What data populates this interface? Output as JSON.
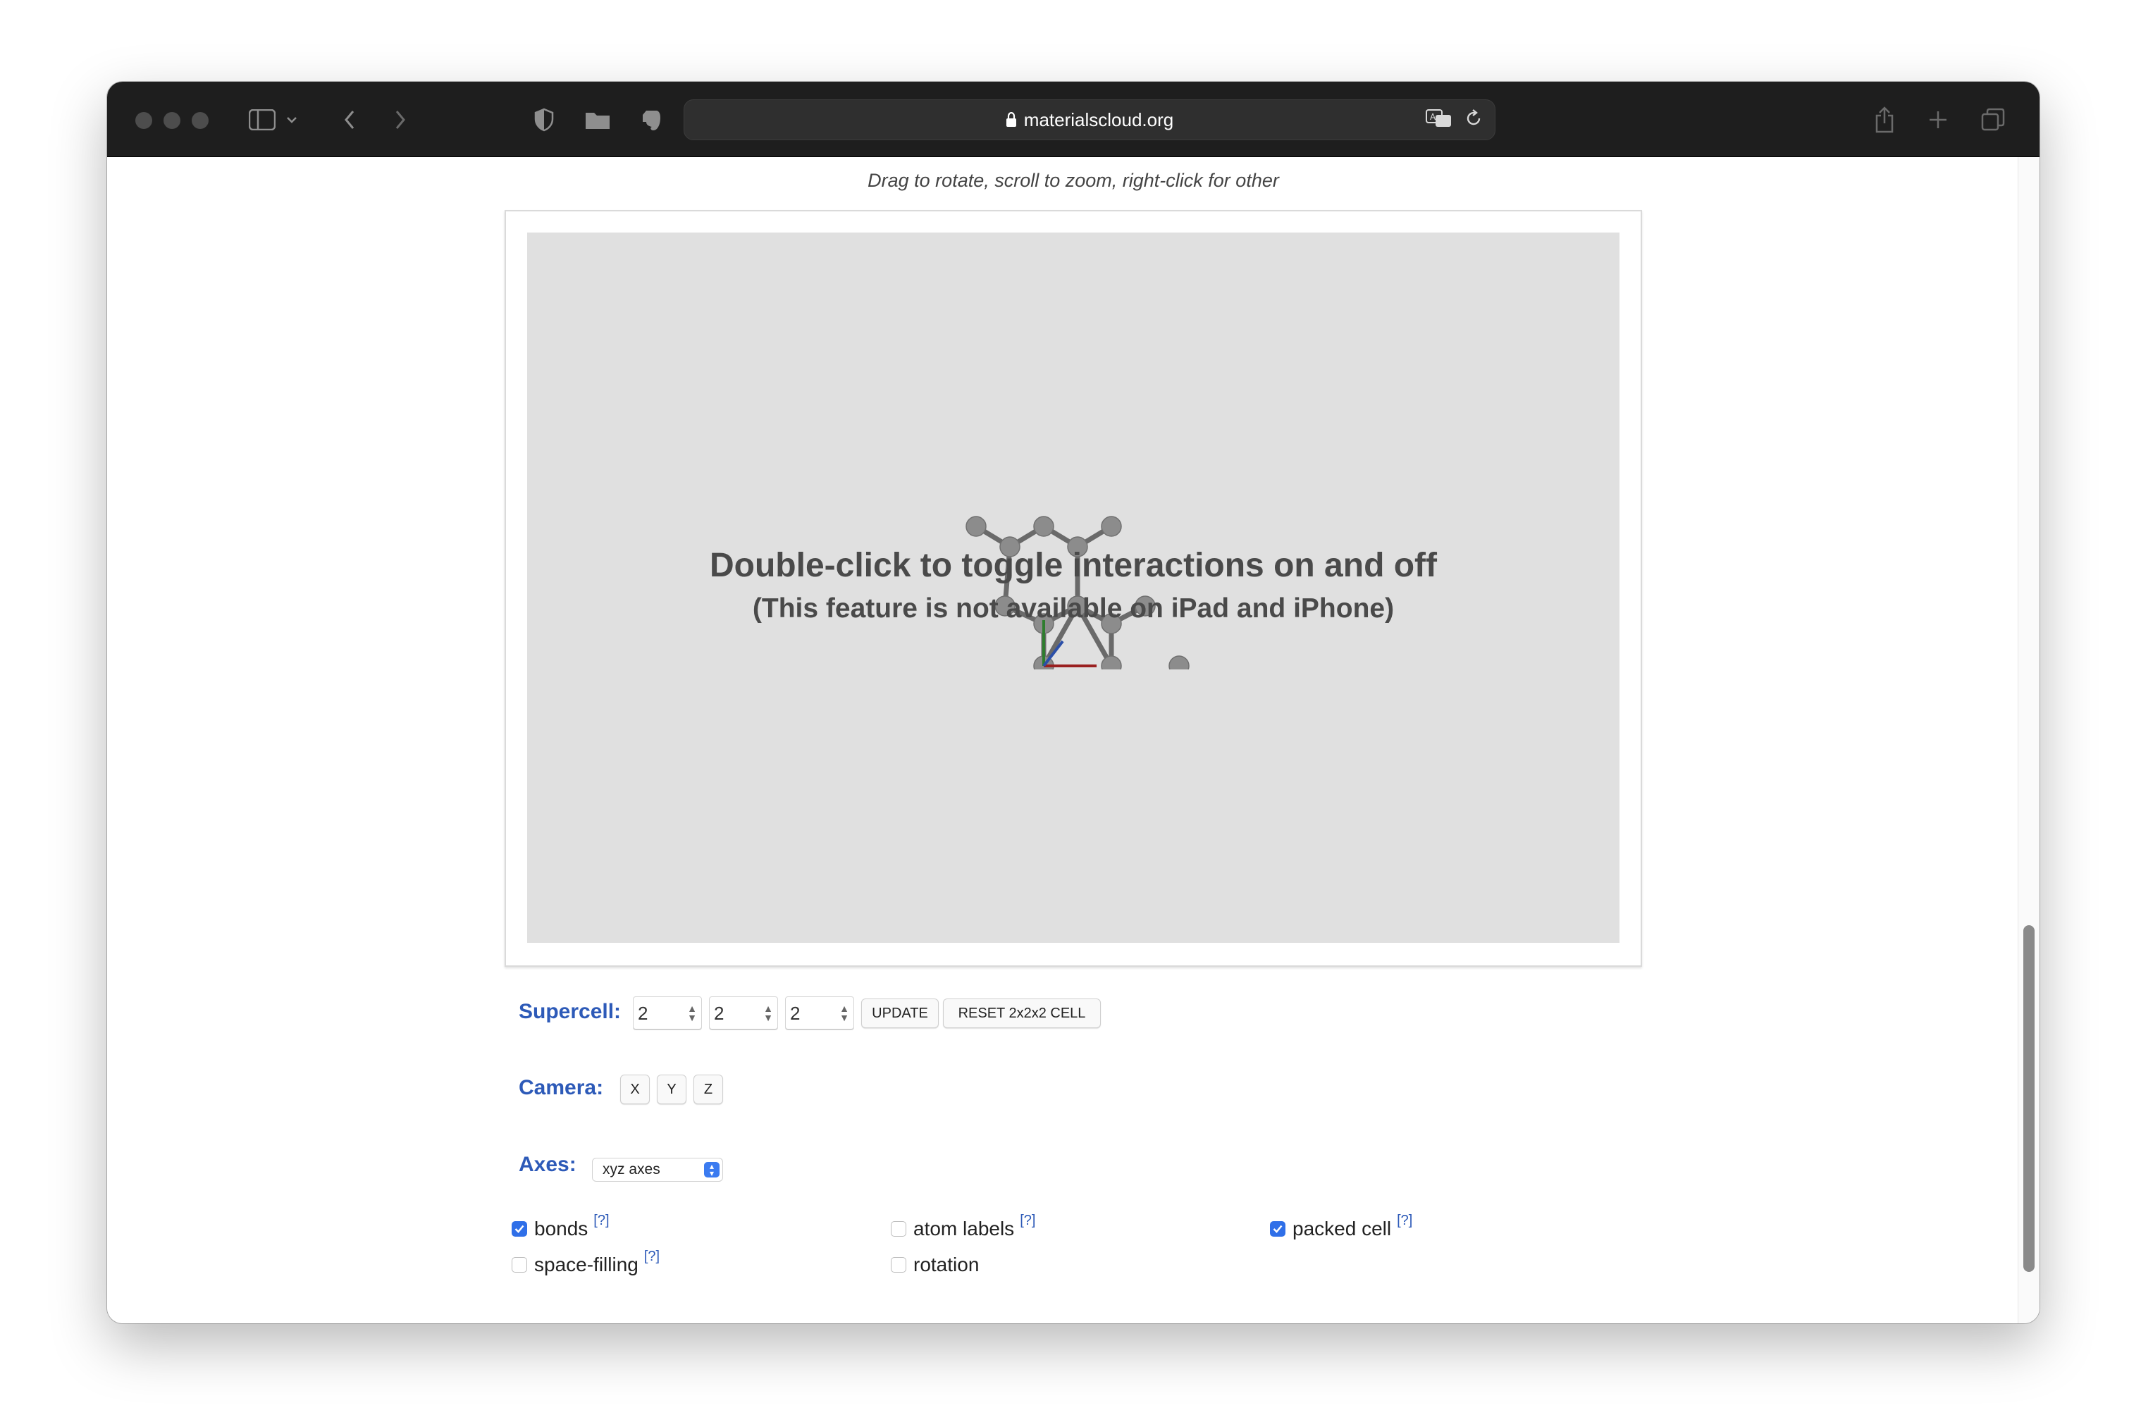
{
  "browser": {
    "url": "materialscloud.org"
  },
  "viewer": {
    "hint": "Drag to rotate, scroll to zoom, right-click for other",
    "overlay_line1": "Double-click to toggle interactions on and off",
    "overlay_line2": "(This feature is not available on iPad and iPhone)"
  },
  "controls": {
    "supercell_label": "Supercell:",
    "supercell_values": [
      "2",
      "2",
      "2"
    ],
    "update_label": "UPDATE",
    "reset_label": "RESET 2x2x2 CELL",
    "camera_label": "Camera:",
    "camera_buttons": [
      "X",
      "Y",
      "Z"
    ],
    "axes_label": "Axes:",
    "axes_selected": "xyz axes",
    "help_marker": "[?]",
    "options": [
      {
        "label": "bonds",
        "checked": true,
        "has_help": true
      },
      {
        "label": "atom labels",
        "checked": false,
        "has_help": true
      },
      {
        "label": "packed cell",
        "checked": true,
        "has_help": true
      },
      {
        "label": "space-filling",
        "checked": false,
        "has_help": true
      },
      {
        "label": "rotation",
        "checked": false,
        "has_help": false
      }
    ]
  },
  "colors": {
    "label_blue": "#2d5ab8",
    "checkbox_blue": "#2f6fe8",
    "viewer_bg": "#e0e0e0",
    "toolbar_bg": "#1e1e1e"
  }
}
